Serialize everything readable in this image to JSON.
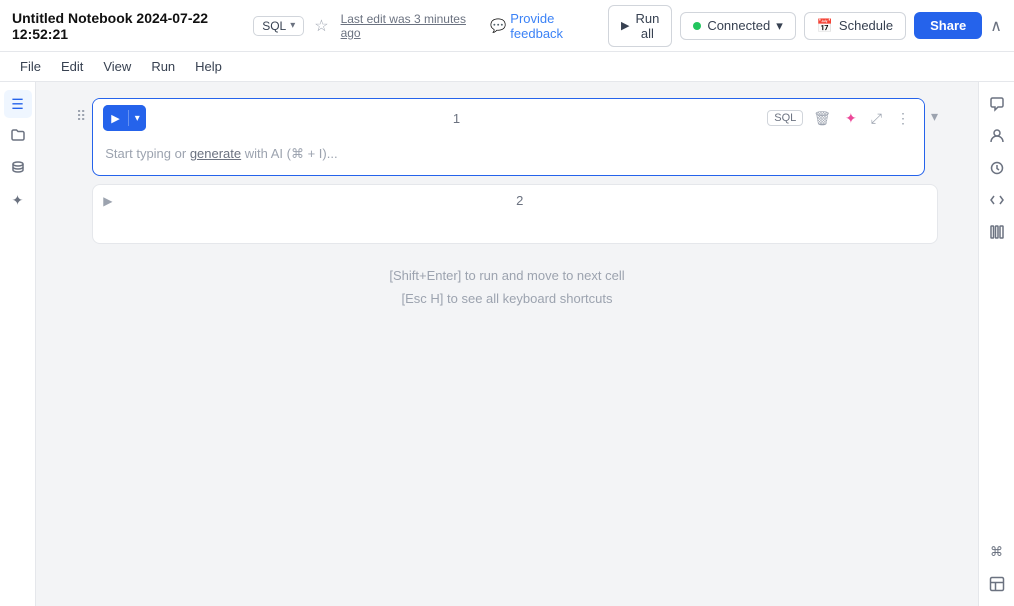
{
  "title": {
    "text": "Untitled Notebook 2024-07-22 12:52:21",
    "sql_label": "SQL",
    "chevron": "▾",
    "star": "☆",
    "last_edit": "Last edit was 3 minutes ago",
    "feedback_icon": "💬",
    "feedback_label": "Provide feedback"
  },
  "toolbar": {
    "run_all_label": "Run all",
    "connected_label": "Connected",
    "schedule_label": "Schedule",
    "share_label": "Share",
    "collapse_label": "^"
  },
  "menu": {
    "items": [
      "File",
      "Edit",
      "View",
      "Run",
      "Help"
    ]
  },
  "left_sidebar": {
    "icons": [
      {
        "name": "notebook-icon",
        "symbol": "☰"
      },
      {
        "name": "folder-icon",
        "symbol": "📁"
      },
      {
        "name": "database-icon",
        "symbol": "◎"
      },
      {
        "name": "sparkle-icon",
        "symbol": "✦"
      }
    ]
  },
  "right_sidebar": {
    "icons": [
      {
        "name": "comment-icon",
        "symbol": "💬"
      },
      {
        "name": "user-icon",
        "symbol": "👤"
      },
      {
        "name": "history-icon",
        "symbol": "⏱"
      },
      {
        "name": "code-icon",
        "symbol": "</>"
      },
      {
        "name": "library-icon",
        "symbol": "|||"
      }
    ],
    "bottom_icons": [
      {
        "name": "keyboard-icon",
        "symbol": "⌘"
      },
      {
        "name": "layout-icon",
        "symbol": "▣"
      }
    ]
  },
  "cells": [
    {
      "id": 1,
      "number": "1",
      "badge": "SQL",
      "placeholder": "Start typing or generate with AI (⌘ + I)...",
      "placeholder_underline": "generate",
      "active": true
    },
    {
      "id": 2,
      "number": "2",
      "active": false
    }
  ],
  "hints": {
    "line1": "[Shift+Enter] to run and move to next cell",
    "line2": "[Esc H] to see all keyboard shortcuts"
  },
  "colors": {
    "accent": "#2563eb",
    "connected": "#22c55e"
  }
}
